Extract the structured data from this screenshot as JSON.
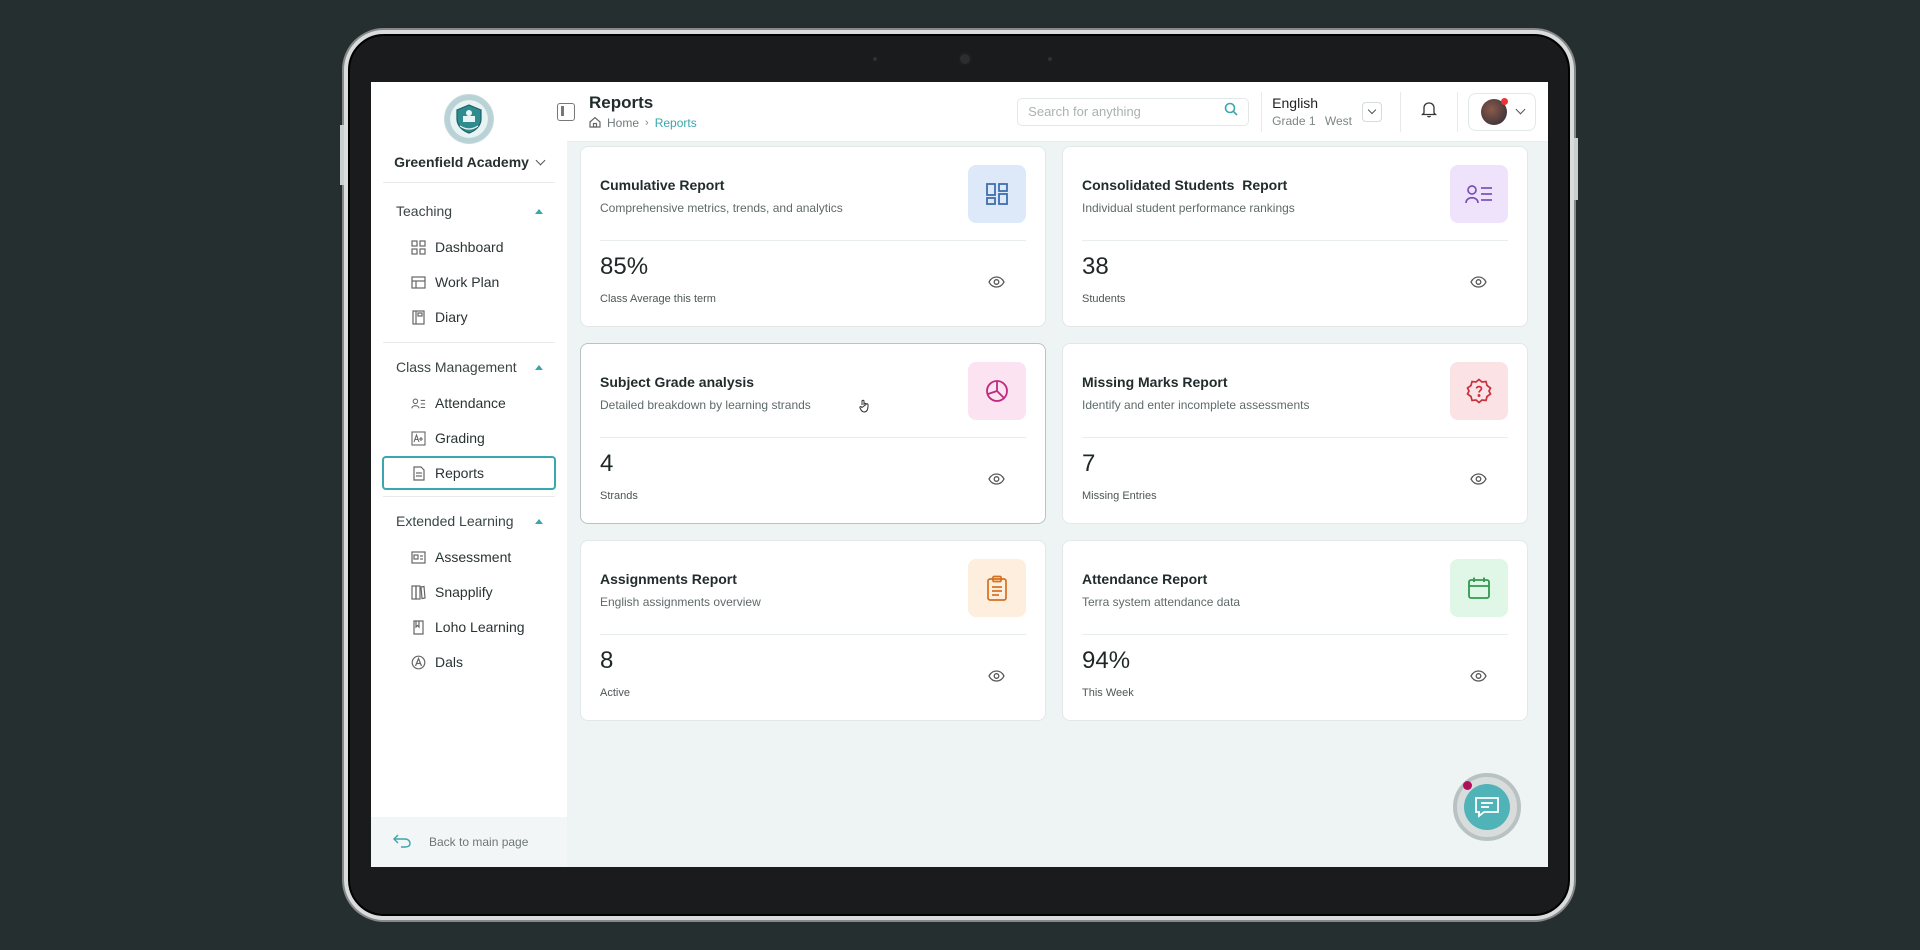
{
  "school": {
    "name": "Greenfield Academy"
  },
  "sidebar": {
    "sections": [
      {
        "title": "Teaching",
        "items": [
          {
            "label": "Dashboard",
            "icon": "dashboard-icon"
          },
          {
            "label": "Work Plan",
            "icon": "table-icon"
          },
          {
            "label": "Diary",
            "icon": "book-icon"
          }
        ]
      },
      {
        "title": "Class Management",
        "items": [
          {
            "label": "Attendance",
            "icon": "user-list-icon"
          },
          {
            "label": "Grading",
            "icon": "grade-icon"
          },
          {
            "label": "Reports",
            "icon": "file-icon",
            "active": true
          }
        ]
      },
      {
        "title": "Extended Learning",
        "items": [
          {
            "label": "Assessment",
            "icon": "id-card-icon"
          },
          {
            "label": "Snapplify",
            "icon": "books-icon"
          },
          {
            "label": "Loho Learning",
            "icon": "bookmark-book-icon"
          },
          {
            "label": "Dals",
            "icon": "compass-icon"
          }
        ]
      }
    ],
    "back_label": "Back to main page"
  },
  "header": {
    "title": "Reports",
    "breadcrumb": {
      "home": "Home",
      "current": "Reports"
    },
    "search_placeholder": "Search for anything",
    "subject": "English",
    "grade": "Grade 1",
    "stream": "West"
  },
  "cards": [
    {
      "title": "Cumulative Report",
      "desc": "Comprehensive metrics, trends, and analytics",
      "value": "85%",
      "label": "Class Average this term",
      "icon": "grid-dashboard-icon",
      "bg": "#dde9f8",
      "fg": "#3f6fae"
    },
    {
      "title": "Consolidated Students  Report",
      "desc": "Individual student performance rankings",
      "value": "38",
      "label": "Students",
      "icon": "user-list-icon",
      "bg": "#efe3fb",
      "fg": "#7a4fb8"
    },
    {
      "title": "Subject Grade analysis",
      "desc": "Detailed breakdown by learning strands",
      "value": "4",
      "label": "Strands",
      "icon": "pie-chart-icon",
      "bg": "#fbe3f1",
      "fg": "#c2287f"
    },
    {
      "title": "Missing Marks Report",
      "desc": "Identify and enter incomplete assessments",
      "value": "7",
      "label": "Missing Entries",
      "icon": "question-badge-icon",
      "bg": "#fbe3e5",
      "fg": "#c9303d"
    },
    {
      "title": "Assignments Report",
      "desc": "English assignments overview",
      "value": "8",
      "label": "Active",
      "icon": "clipboard-icon",
      "bg": "#fdeede",
      "fg": "#d66f1f"
    },
    {
      "title": "Attendance Report",
      "desc": "Terra system attendance data",
      "value": "94%",
      "label": "This Week",
      "icon": "calendar-icon",
      "bg": "#e0f6e7",
      "fg": "#2f9a4e"
    }
  ],
  "colors": {
    "accent": "#3aa6ad",
    "background": "#eef3f3"
  }
}
